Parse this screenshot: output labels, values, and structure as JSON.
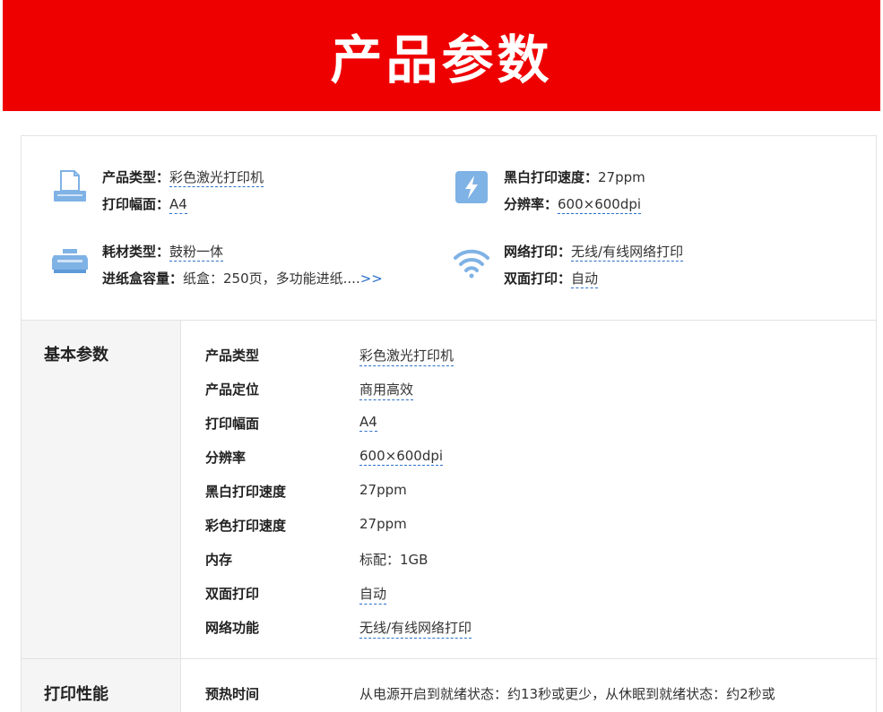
{
  "banner": {
    "title": "产品参数"
  },
  "summary": {
    "left": [
      {
        "icon": "printer-icon",
        "lines": [
          {
            "label": "产品类型：",
            "value": "彩色激光打印机",
            "link": true
          },
          {
            "label": "打印幅面：",
            "value": "A4",
            "link": true
          }
        ]
      },
      {
        "icon": "toner-cartridge-icon",
        "lines": [
          {
            "label": "耗材类型：",
            "value": "鼓粉一体",
            "link": true
          },
          {
            "label": "进纸盒容量：",
            "value": "纸盒：250页，多功能进纸....",
            "link": false,
            "more": ">>"
          }
        ]
      }
    ],
    "right": [
      {
        "icon": "lightning-bolt-icon",
        "lines": [
          {
            "label": "黑白打印速度：",
            "value": "27ppm",
            "link": false
          },
          {
            "label": "分辨率：",
            "value": "600×600dpi",
            "link": true
          }
        ]
      },
      {
        "icon": "wifi-icon",
        "lines": [
          {
            "label": "网络打印：",
            "value": "无线/有线网络打印",
            "link": true
          },
          {
            "label": "双面打印：",
            "value": "自动",
            "link": true
          }
        ]
      }
    ]
  },
  "sections": [
    {
      "title": "基本参数",
      "rows": [
        {
          "key": "产品类型",
          "value": "彩色激光打印机",
          "link": true
        },
        {
          "key": "产品定位",
          "value": "商用高效",
          "link": true
        },
        {
          "key": "打印幅面",
          "value": "A4",
          "link": true
        },
        {
          "key": "分辨率",
          "value": "600×600dpi",
          "link": true
        },
        {
          "key": "黑白打印速度",
          "value": "27ppm",
          "link": false
        },
        {
          "key": "彩色打印速度",
          "value": "27ppm",
          "link": false
        },
        {
          "key": "内存",
          "value": "标配：1GB",
          "link": false
        },
        {
          "key": "双面打印",
          "value": "自动",
          "link": true
        },
        {
          "key": "网络功能",
          "value": "无线/有线网络打印",
          "link": true
        }
      ]
    },
    {
      "title": "打印性能",
      "rows": [
        {
          "key": "预热时间",
          "value": "从电源开启到就绪状态：约13秒或更少，从休眠到就绪状态：约2秒或",
          "link": false
        }
      ]
    }
  ]
}
